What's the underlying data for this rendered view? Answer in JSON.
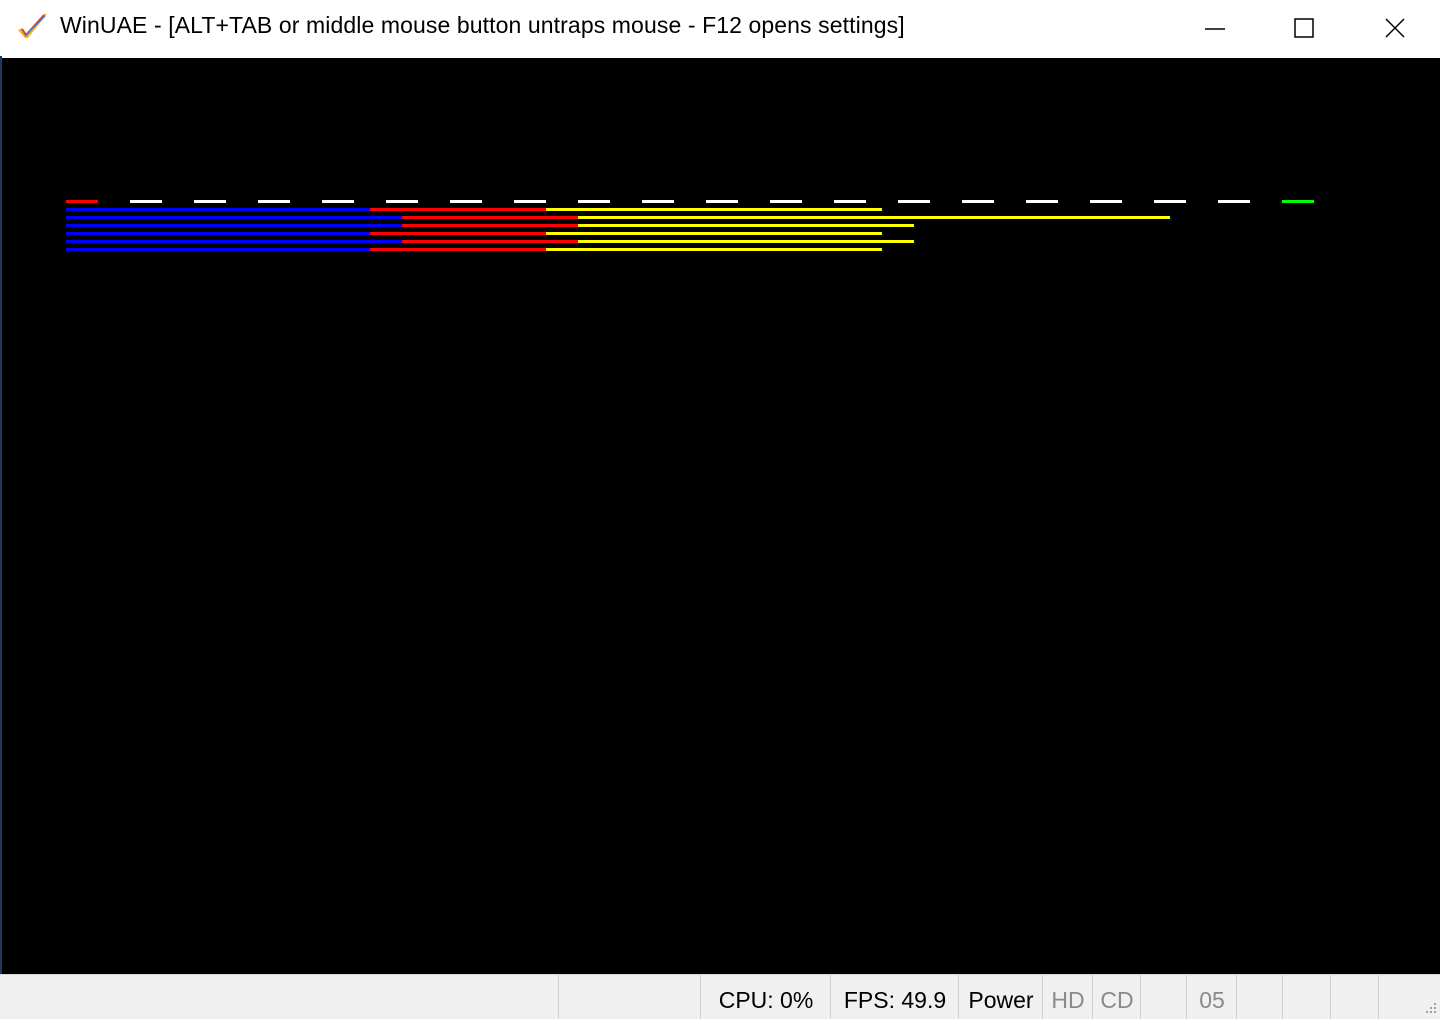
{
  "window": {
    "title": "WinUAE - [ALT+TAB or middle mouse button untraps mouse - F12 opens settings]",
    "app_icon": "winuae-checkmark-icon",
    "controls": [
      "minimize-icon",
      "maximize-icon",
      "close-icon"
    ]
  },
  "emulator": {
    "background": "#000000",
    "colors": {
      "blue": "#0000ff",
      "red": "#ff0000",
      "yellow": "#ffff00",
      "white": "#ffffff",
      "green": "#00ff00"
    }
  },
  "statusbar": {
    "cpu": "CPU: 0%",
    "fps": "FPS: 49.9",
    "power": "Power",
    "hd": "HD",
    "cd": "CD",
    "drive": "05"
  }
}
